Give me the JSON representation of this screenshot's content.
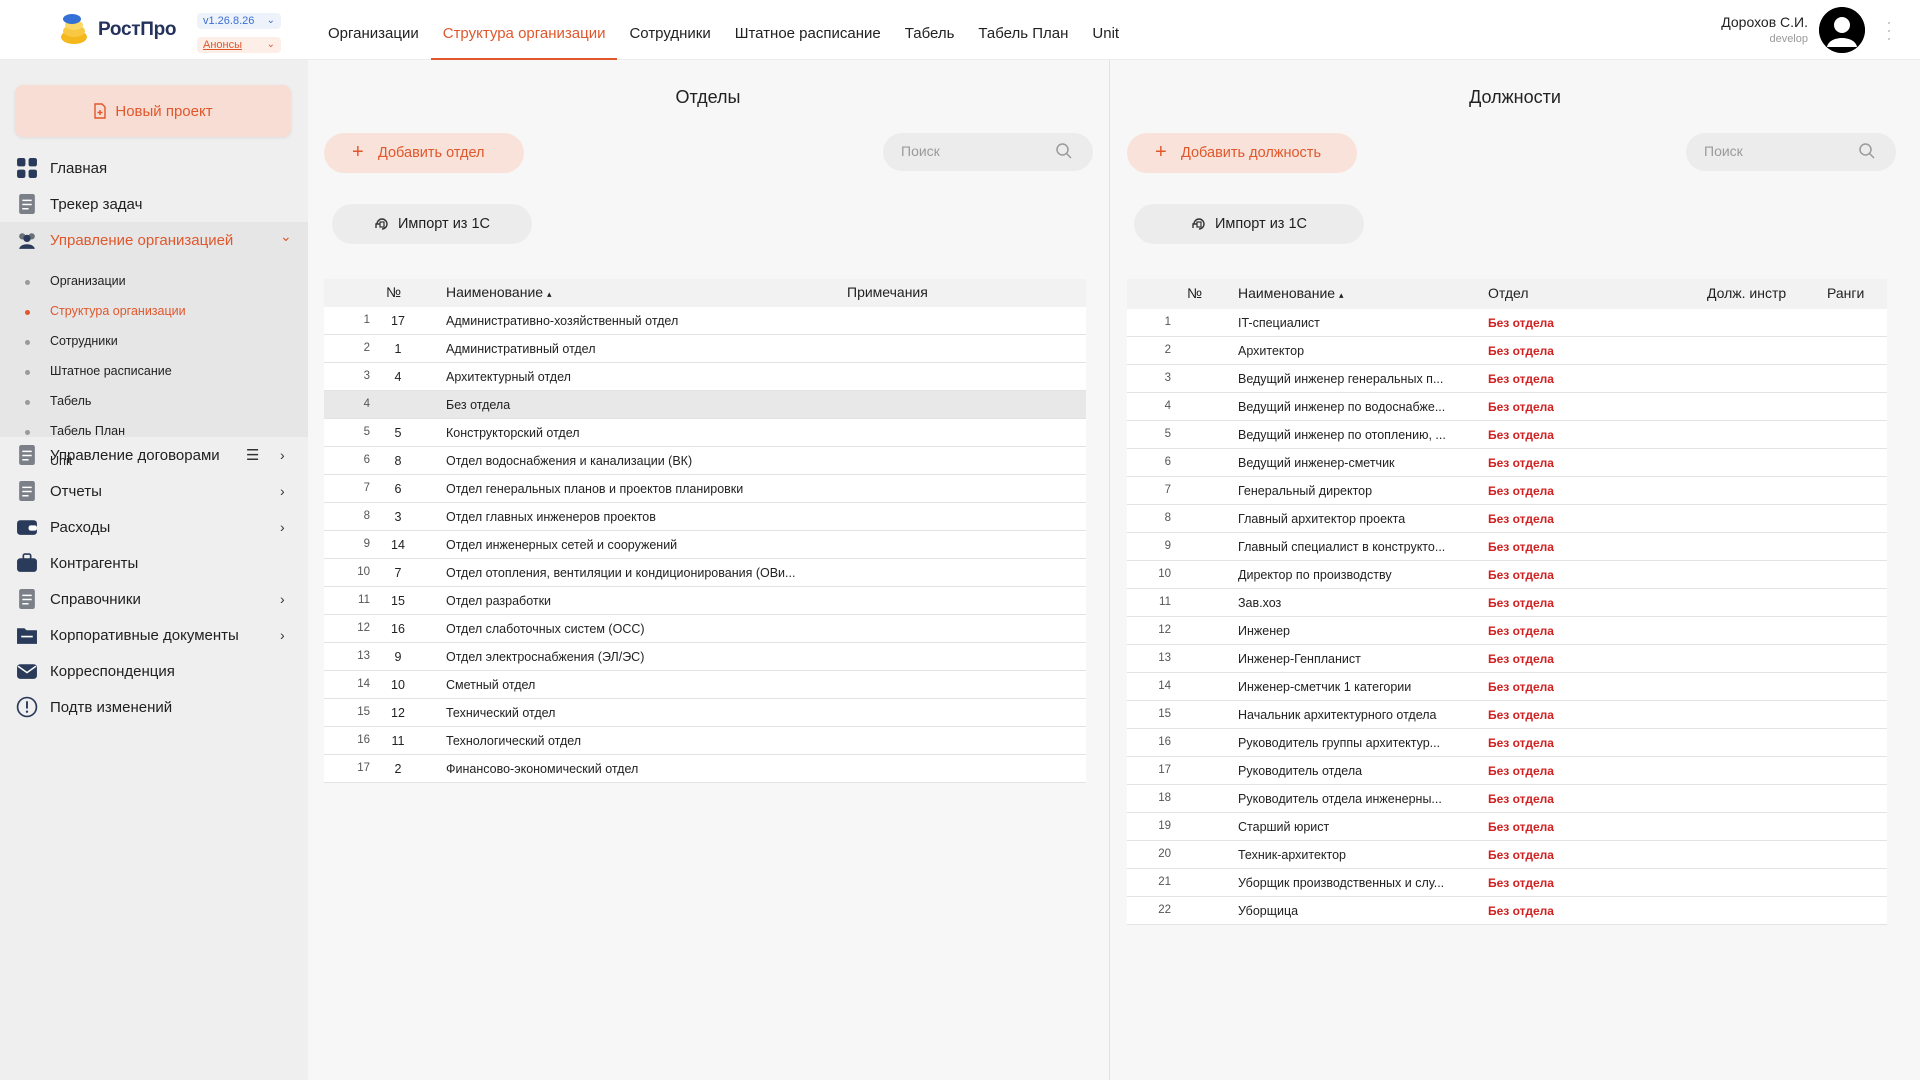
{
  "app": {
    "brand": "РостПро",
    "version": "v1.26.8.26",
    "announcements": "Анонсы"
  },
  "topnav": [
    "Организации",
    "Структура организации",
    "Сотрудники",
    "Штатное расписание",
    "Табель",
    "Табель План",
    "Unit"
  ],
  "topnav_active": 1,
  "user": {
    "name": "Дорохов С.И.",
    "role": "develop"
  },
  "sidebar": {
    "new_project": "Новый проект",
    "items": [
      {
        "label": "Главная",
        "icon": "grid-icon"
      },
      {
        "label": "Трекер задач",
        "icon": "document-icon"
      },
      {
        "label": "Управление организацией",
        "icon": "people-icon"
      },
      {
        "label": "Управление договорами",
        "icon": "document-icon"
      },
      {
        "label": "Отчеты",
        "icon": "document-icon"
      },
      {
        "label": "Расходы",
        "icon": "wallet-icon"
      },
      {
        "label": "Контрагенты",
        "icon": "briefcase-icon"
      },
      {
        "label": "Справочники",
        "icon": "document-icon"
      },
      {
        "label": "Корпоративные документы",
        "icon": "folder-icon"
      },
      {
        "label": "Корреспонденция",
        "icon": "mail-icon"
      },
      {
        "label": "Подтв изменений",
        "icon": "alert-circle-icon"
      }
    ],
    "subitems": [
      "Организации",
      "Структура организации",
      "Сотрудники",
      "Штатное расписание",
      "Табель",
      "Табель План",
      "Unit"
    ],
    "active_sub": 1
  },
  "departments": {
    "title": "Отделы",
    "add_label": "Добавить отдел",
    "search_placeholder": "Поиск",
    "import_label": "Импорт из 1С",
    "columns": [
      "№",
      "Наименование",
      "Примечания"
    ],
    "sort_arrow": "▴",
    "rows": [
      {
        "i": "1",
        "code": "17",
        "name": "Административно-хозяйственный отдел"
      },
      {
        "i": "2",
        "code": "1",
        "name": "Административный отдел"
      },
      {
        "i": "3",
        "code": "4",
        "name": "Архитектурный отдел"
      },
      {
        "i": "4",
        "code": "",
        "name": "Без отдела"
      },
      {
        "i": "5",
        "code": "5",
        "name": "Конструкторский отдел"
      },
      {
        "i": "6",
        "code": "8",
        "name": "Отдел водоснабжения и канализации (ВК)"
      },
      {
        "i": "7",
        "code": "6",
        "name": "Отдел генеральных планов и проектов планировки"
      },
      {
        "i": "8",
        "code": "3",
        "name": "Отдел главных инженеров проектов"
      },
      {
        "i": "9",
        "code": "14",
        "name": "Отдел инженерных сетей и сооружений"
      },
      {
        "i": "10",
        "code": "7",
        "name": "Отдел отопления, вентиляции и кондиционирования (ОВи..."
      },
      {
        "i": "11",
        "code": "15",
        "name": "Отдел разработки"
      },
      {
        "i": "12",
        "code": "16",
        "name": "Отдел слаботочных систем (ОСС)"
      },
      {
        "i": "13",
        "code": "9",
        "name": "Отдел электроснабжения (ЭЛ/ЭС)"
      },
      {
        "i": "14",
        "code": "10",
        "name": "Сметный отдел"
      },
      {
        "i": "15",
        "code": "12",
        "name": "Технический отдел"
      },
      {
        "i": "16",
        "code": "11",
        "name": "Технологический отдел"
      },
      {
        "i": "17",
        "code": "2",
        "name": "Финансово-экономический отдел"
      }
    ],
    "highlight_row": 3
  },
  "positions": {
    "title": "Должности",
    "add_label": "Добавить должность",
    "search_placeholder": "Поиск",
    "import_label": "Импорт из 1С",
    "columns": [
      "№",
      "Наименование",
      "Отдел",
      "Долж. инстр",
      "Ранги"
    ],
    "sort_arrow": "▴",
    "no_dept": "Без отдела",
    "rows": [
      {
        "i": "1",
        "name": "IT-специалист"
      },
      {
        "i": "2",
        "name": "Архитектор"
      },
      {
        "i": "3",
        "name": "Ведущий инженер генеральных п..."
      },
      {
        "i": "4",
        "name": "Ведущий инженер по водоснабже..."
      },
      {
        "i": "5",
        "name": "Ведущий инженер по отоплению, ..."
      },
      {
        "i": "6",
        "name": "Ведущий инженер-сметчик"
      },
      {
        "i": "7",
        "name": "Генеральный директор"
      },
      {
        "i": "8",
        "name": "Главный архитектор проекта"
      },
      {
        "i": "9",
        "name": "Главный специалист в конструкто..."
      },
      {
        "i": "10",
        "name": "Директор по производству"
      },
      {
        "i": "11",
        "name": "Зав.хоз"
      },
      {
        "i": "12",
        "name": "Инженер"
      },
      {
        "i": "13",
        "name": "Инженер-Генпланист"
      },
      {
        "i": "14",
        "name": "Инженер-сметчик 1 категории"
      },
      {
        "i": "15",
        "name": "Начальник архитектурного отдела"
      },
      {
        "i": "16",
        "name": "Руководитель группы архитектур..."
      },
      {
        "i": "17",
        "name": "Руководитель отдела"
      },
      {
        "i": "18",
        "name": "Руководитель отдела инженерны..."
      },
      {
        "i": "19",
        "name": "Старший юрист"
      },
      {
        "i": "20",
        "name": "Техник-архитектор"
      },
      {
        "i": "21",
        "name": "Уборщик производственных и слу..."
      },
      {
        "i": "22",
        "name": "Уборщица"
      }
    ]
  },
  "colors": {
    "accent": "#e0572c",
    "accent_soft": "#f9e2d9",
    "danger": "#d02020",
    "sidebar_bg": "#efefef"
  }
}
